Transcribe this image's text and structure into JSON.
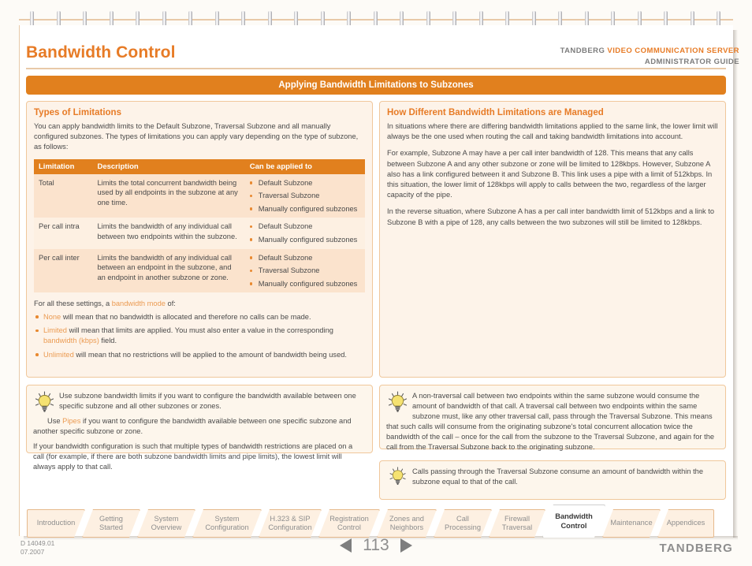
{
  "header": {
    "title": "Bandwidth Control",
    "brand_prefix": "TANDBERG ",
    "brand_product": "VIDEO COMMUNICATION SERVER",
    "brand_subtitle": "ADMINISTRATOR GUIDE",
    "banner": "Applying Bandwidth Limitations to Subzones"
  },
  "left_panel": {
    "heading": "Types of Limitations",
    "intro": "You can apply bandwidth limits to the Default Subzone, Traversal Subzone and all manually configured subzones.  The types of limitations you can apply vary depending on the type of subzone, as follows:",
    "table": {
      "columns": [
        "Limitation",
        "Description",
        "Can be applied to"
      ],
      "rows": [
        {
          "limitation": "Total",
          "description": "Limits the total concurrent bandwidth being used by all endpoints in the subzone at any one time.",
          "applies_to": [
            "Default Subzone",
            "Traversal Subzone",
            "Manually configured subzones"
          ]
        },
        {
          "limitation": "Per call intra",
          "description": "Limits the bandwidth of any individual call between two endpoints within the subzone.",
          "applies_to": [
            "Default Subzone",
            "Manually configured subzones"
          ]
        },
        {
          "limitation": "Per call inter",
          "description": "Limits the bandwidth of any individual call between an endpoint in the subzone, and an endpoint in another subzone or zone.",
          "applies_to": [
            "Default Subzone",
            "Traversal Subzone",
            "Manually configured subzones"
          ]
        }
      ]
    },
    "modes_intro_pre": "For all these settings, a ",
    "modes_intro_link": "bandwidth mode",
    "modes_intro_post": " of:",
    "modes": [
      {
        "term": "None",
        "text": " will mean that no bandwidth is allocated and therefore no calls can be made."
      },
      {
        "term": "Limited",
        "text": " will mean that limits are applied.  You must also enter a value in the corresponding ",
        "link2": "bandwidth (kbps)",
        "text2": " field."
      },
      {
        "term": "Unlimited",
        "text": " will mean that no restrictions will be applied to the amount of bandwidth being used."
      }
    ]
  },
  "right_panel": {
    "heading": "How Different Bandwidth Limitations are Managed",
    "paragraphs": [
      "In situations where there are differing bandwidth limitations applied to the same link, the lower limit will always be the one used when routing the call and taking bandwidth limitations into account.",
      "For example, Subzone A may have a per call inter bandwidth of 128.  This means that any calls between Subzone A and any other subzone or zone will be limited to 128kbps.  However, Subzone A also has a link configured between it and Subzone B.  This link uses a pipe with a limit of 512kbps.  In this situation, the lower limit of 128kbps will apply to calls between the two, regardless of the larger capacity of the pipe.",
      "In the reverse situation, where Subzone A has a per call inter bandwidth limit of 512kbps and a link to Subzone B with a pipe of 128, any calls between the two subzones will still be limited to 128kbps."
    ]
  },
  "tips": {
    "left": {
      "p1": "Use subzone bandwidth limits if you want to configure the bandwidth available between one specific subzone and all other subzones or zones.",
      "p2_pre": "Use ",
      "p2_link": "Pipes",
      "p2_post": " if you want to configure the bandwidth available between one specific subzone and another specific subzone or zone.",
      "p3": "If your bandwidth configuration is such that multiple types of bandwidth restrictions are placed on a call (for example, if there are both subzone bandwidth limits and pipe limits), the lowest limit will always apply to that call."
    },
    "right_1": "A non-traversal call between two endpoints within the same subzone would consume the amount of bandwidth of that call.  A traversal call between two endpoints within the same subzone must, like any other traversal call, pass through the Traversal Subzone.  This means that such calls will consume from the originating subzone's total concurrent allocation twice the bandwidth of the call – once for the call from the subzone to the Traversal Subzone, and again for the call from the Traversal Subzone back to the originating subzone.",
    "right_2": "Calls passing through the Traversal Subzone consume an amount of bandwidth within the subzone equal to that of the call."
  },
  "tabs": [
    {
      "label": "Introduction",
      "active": false
    },
    {
      "label": "Getting\nStarted",
      "active": false
    },
    {
      "label": "System\nOverview",
      "active": false
    },
    {
      "label": "System\nConfiguration",
      "active": false
    },
    {
      "label": "H.323 & SIP\nConfiguration",
      "active": false
    },
    {
      "label": "Registration\nControl",
      "active": false
    },
    {
      "label": "Zones and\nNeighbors",
      "active": false
    },
    {
      "label": "Call\nProcessing",
      "active": false
    },
    {
      "label": "Firewall\nTraversal",
      "active": false
    },
    {
      "label": "Bandwidth\nControl",
      "active": true
    },
    {
      "label": "Maintenance",
      "active": false
    },
    {
      "label": "Appendices",
      "active": false
    }
  ],
  "footer": {
    "doc_code": "D 14049.01",
    "doc_date": "07.2007",
    "page_number": "113",
    "logo": "TANDBERG"
  },
  "colors": {
    "accent": "#e77b26",
    "banner": "#e1801e",
    "panel_bg": "#fdf3e9",
    "panel_border": "#f0c79b",
    "text": "#4a4a4a",
    "muted": "#8e8e8e",
    "link": "#eb9b52"
  }
}
